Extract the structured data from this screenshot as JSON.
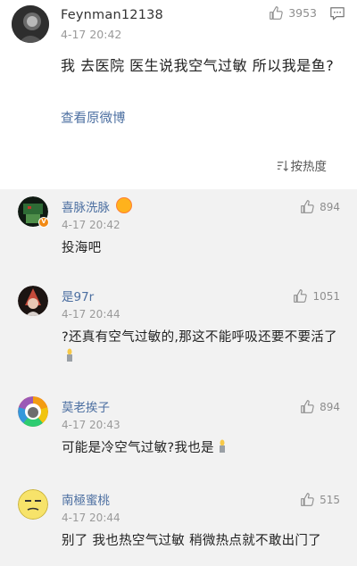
{
  "post": {
    "username": "Feynman12138",
    "time": "4-17 20:42",
    "likes": "3953",
    "text": "我 去医院 医生说我空气过敏 所以我是鱼?",
    "origin_link": "查看原微博",
    "sort_label": "按热度"
  },
  "comments": [
    {
      "username": "喜脉洗脉",
      "time": "4-17 20:42",
      "likes": "894",
      "text": "投海吧"
    },
    {
      "username": "是97r",
      "time": "4-17 20:44",
      "likes": "1051",
      "text": "?还真有空气过敏的,那这不能呼吸还要不要活了"
    },
    {
      "username": "莫老挨子",
      "time": "4-17 20:43",
      "likes": "894",
      "text": "可能是冷空气过敏?我也是"
    },
    {
      "username": "南極蜜桃",
      "time": "4-17 20:44",
      "likes": "515",
      "text": "别了 我也热空气过敏 稍微热点就不敢出门了"
    }
  ]
}
